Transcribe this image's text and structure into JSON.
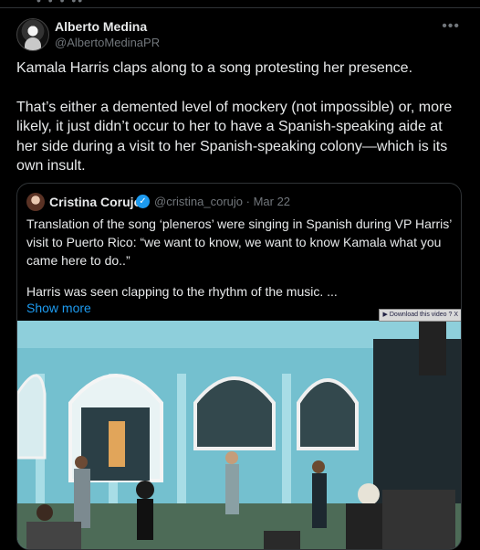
{
  "top": {
    "dots_label": "• • • ••"
  },
  "post": {
    "author_name": "Alberto Medina",
    "author_handle": "@AlbertoMedinaPR",
    "more_icon": "•••",
    "paragraphs": [
      "Kamala Harris claps along to a song protesting her presence.",
      "That’s either a demented level of mockery (not impossible) or, more likely, it just didn’t occur to her to have a Spanish-speaking aide at her side during a visit to her Spanish-speaking colony—which is its own insult."
    ]
  },
  "quote": {
    "author_name": "Cristina Corujo",
    "verified_icon": "✓",
    "meta": "@cristina_corujo · Mar 22",
    "paragraphs": [
      "Translation of the song ‘pleneros’ were singing in Spanish during VP Harris’ visit to Puerto Rico: “we want to know, we want to know Kamala what you came here to do..”",
      "Harris was seen clapping to the rhythm of the music. ..."
    ],
    "show_more": "Show more",
    "download_label": "Download this video",
    "download_extra": "? X"
  },
  "colors": {
    "background": "#000000",
    "text": "#e7e9ea",
    "secondary": "#71767b",
    "link": "#1d9bf0",
    "border": "#2f3336"
  }
}
